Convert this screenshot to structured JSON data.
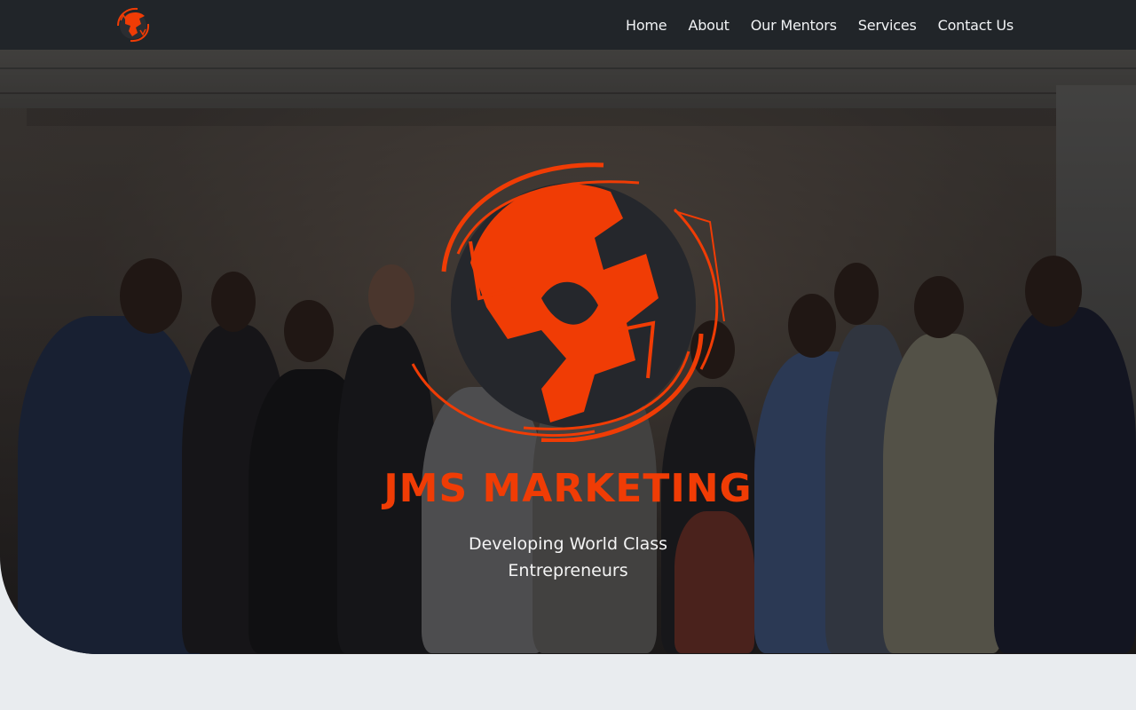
{
  "brand": {
    "logo_icon": "globe-arrows-logo",
    "accent_color": "#f03c05",
    "dark_color": "#212529"
  },
  "nav": {
    "items": [
      {
        "label": "Home"
      },
      {
        "label": "About"
      },
      {
        "label": "Our Mentors"
      },
      {
        "label": "Services"
      },
      {
        "label": "Contact Us"
      }
    ]
  },
  "hero": {
    "title": "JMS MARKETING",
    "subtitle": "Developing World Class Entrepreneurs"
  }
}
